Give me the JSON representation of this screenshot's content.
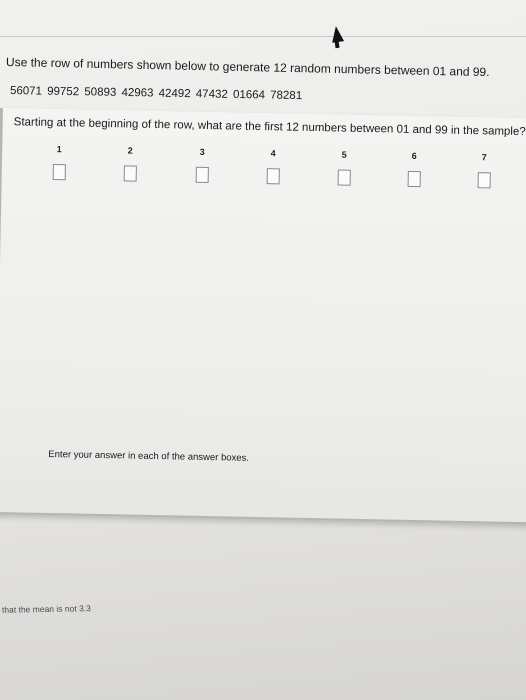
{
  "header": {
    "instruction": "Use the row of numbers shown below to generate 12 random numbers between 01 and 99.",
    "number_row": "56071 99752 50893 42963 42492 47432 01664 78281"
  },
  "question": {
    "text": "Starting at the beginning of the row, what are the first 12 numbers between 01 and 99 in the sample?",
    "columns": [
      {
        "label": "1",
        "value": ""
      },
      {
        "label": "2",
        "value": ""
      },
      {
        "label": "3",
        "value": ""
      },
      {
        "label": "4",
        "value": ""
      },
      {
        "label": "5",
        "value": ""
      },
      {
        "label": "6",
        "value": ""
      },
      {
        "label": "7",
        "value": ""
      }
    ],
    "footer_note": "Enter your answer in each of the answer boxes."
  },
  "background": {
    "partial_text": "that the mean is not 3.3"
  },
  "colors": {
    "page": "#eeeeec",
    "text": "#1b1b1b",
    "box_border": "#8a8a8a"
  }
}
